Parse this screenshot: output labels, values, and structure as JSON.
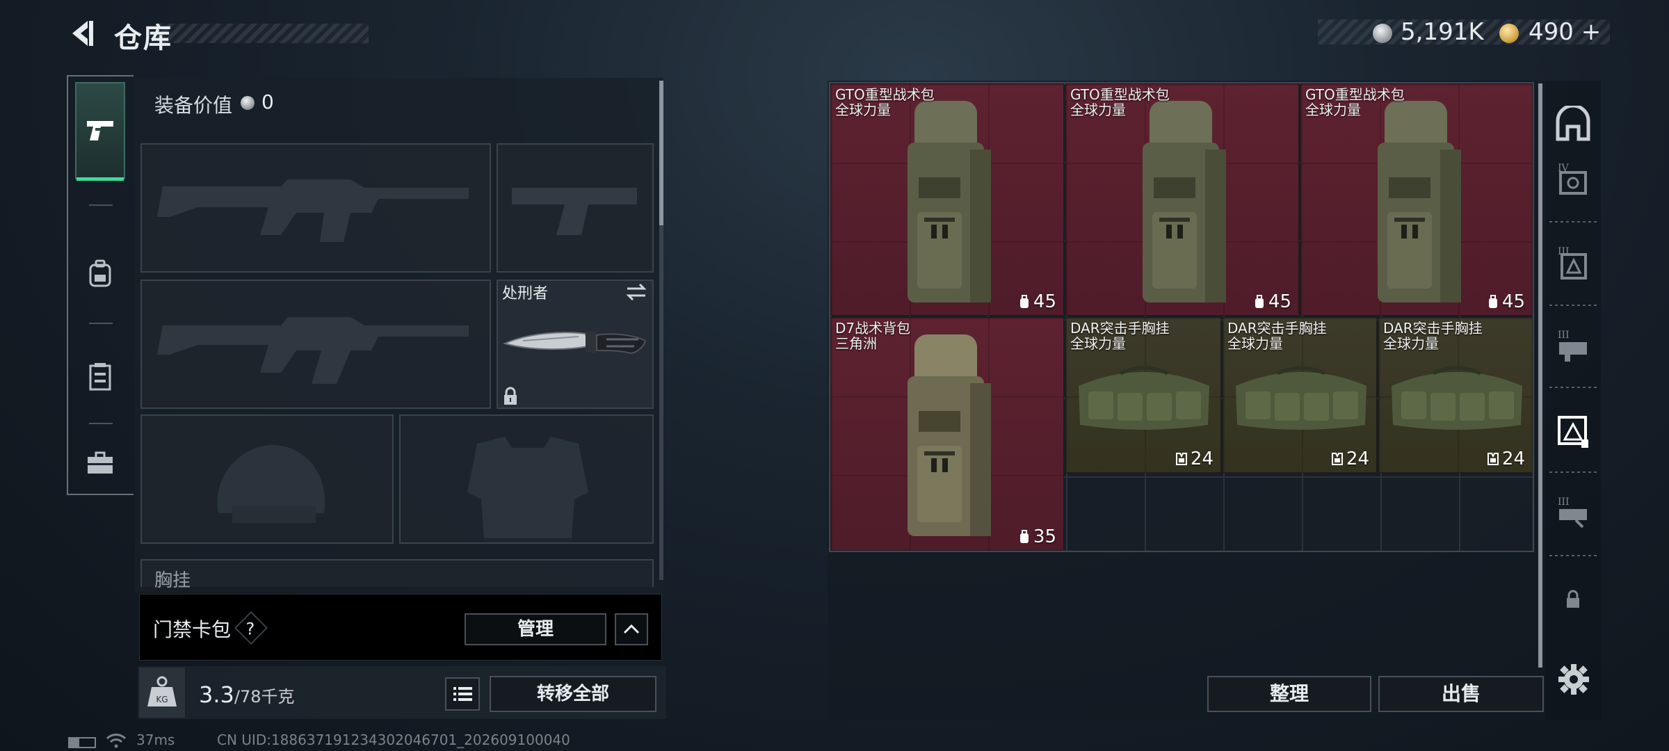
{
  "header": {
    "title": "仓库",
    "silver_amount": "5,191K",
    "gold_amount": "490",
    "gold_plus": "+"
  },
  "loadout": {
    "equip_value_label": "装备价值",
    "equip_value": "0",
    "melee_name": "处刑者",
    "chest_label": "胸挂"
  },
  "keycard": {
    "label": "门禁卡包",
    "help": "?",
    "manage_label": "管理"
  },
  "weight": {
    "current": "3.3",
    "max": "/78千克",
    "icon_text": "KG"
  },
  "actions": {
    "transfer_all": "转移全部",
    "sort": "整理",
    "sell": "出售"
  },
  "status": {
    "ping": "37ms",
    "uid": "CN UID:18863719123430204670​1_202609100040"
  },
  "warehouse": {
    "items": [
      {
        "name": "GTO重型战术包",
        "sub": "全球力量",
        "capacity": "45",
        "color": "red"
      },
      {
        "name": "GTO重型战术包",
        "sub": "全球力量",
        "capacity": "45",
        "color": "red"
      },
      {
        "name": "GTO重型战术包",
        "sub": "全球力量",
        "capacity": "45",
        "color": "red"
      },
      {
        "name": "D7战术背包",
        "sub": "三角洲",
        "capacity": "35",
        "color": "red"
      },
      {
        "name": "DAR突击手胸挂",
        "sub": "全球力量",
        "capacity": "24",
        "color": "olive"
      },
      {
        "name": "DAR突击手胸挂",
        "sub": "全球力量",
        "capacity": "24",
        "color": "olive"
      },
      {
        "name": "DAR突击手胸挂",
        "sub": "全球力量",
        "capacity": "24",
        "color": "olive"
      }
    ]
  },
  "categories": [
    "all-icon",
    "tier-4-bag-icon",
    "tier-3-bag-icon",
    "tier-3-rig-icon",
    "backpack-category-icon",
    "tier-3-armor-icon",
    "locked-category-icon"
  ],
  "colors": {
    "accent_green": "#3ddc9a",
    "item_red": "#5e2230",
    "item_olive": "#3d3a2a"
  }
}
